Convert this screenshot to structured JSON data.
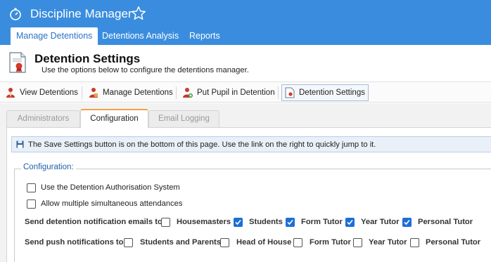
{
  "app": {
    "title": "Discipline Manager",
    "icon": "stopwatch-icon",
    "favorite_icon": "star-outline-icon"
  },
  "nav": {
    "tabs": [
      {
        "label": "Manage Detentions",
        "active": true
      },
      {
        "label": "Detentions Analysis",
        "active": false
      },
      {
        "label": "Reports",
        "active": false
      }
    ]
  },
  "page": {
    "title": "Detention Settings",
    "subtitle": "Use the options below to configure the detentions manager.",
    "icon": "document-ribbon-icon"
  },
  "toolbar": {
    "items": [
      {
        "label": "View Detentions",
        "icon": "pupil-icon"
      },
      {
        "label": "Manage Detentions",
        "icon": "pupil-edit-icon"
      },
      {
        "label": "Put Pupil in Detention",
        "icon": "pupil-add-icon"
      },
      {
        "label": "Detention Settings",
        "icon": "document-ribbon-icon",
        "active": true
      }
    ]
  },
  "tabs": [
    {
      "label": "Administrators",
      "active": false
    },
    {
      "label": "Configuration",
      "active": true
    },
    {
      "label": "Email Logging",
      "active": false
    }
  ],
  "info": {
    "icon": "save-icon",
    "text": "The Save Settings button is on the bottom of this page. Use the link on the right to quickly jump to it."
  },
  "configuration": {
    "legend": "Configuration:",
    "options": [
      {
        "label": "Use the Detention Authorisation System",
        "checked": false
      },
      {
        "label": "Allow multiple simultaneous attendances",
        "checked": false
      }
    ],
    "email_notifications": {
      "label": "Send detention notification emails to:",
      "choices": [
        {
          "label": "Housemasters",
          "checked": false
        },
        {
          "label": "Students",
          "checked": true
        },
        {
          "label": "Form Tutor",
          "checked": true
        },
        {
          "label": "Year Tutor",
          "checked": true
        },
        {
          "label": "Personal Tutor",
          "checked": true
        }
      ]
    },
    "push_notifications": {
      "label": "Send push notifications to:",
      "choices": [
        {
          "label": "Students and Parents",
          "checked": false
        },
        {
          "label": "Head of House",
          "checked": false
        },
        {
          "label": "Form Tutor",
          "checked": false
        },
        {
          "label": "Year Tutor",
          "checked": false
        },
        {
          "label": "Personal Tutor",
          "checked": false
        }
      ]
    }
  },
  "colors": {
    "header_blue": "#3a8dde",
    "checkbox_blue": "#1d6fd6",
    "tab_accent": "#f0a24a",
    "legend_blue": "#1e5fa8"
  }
}
